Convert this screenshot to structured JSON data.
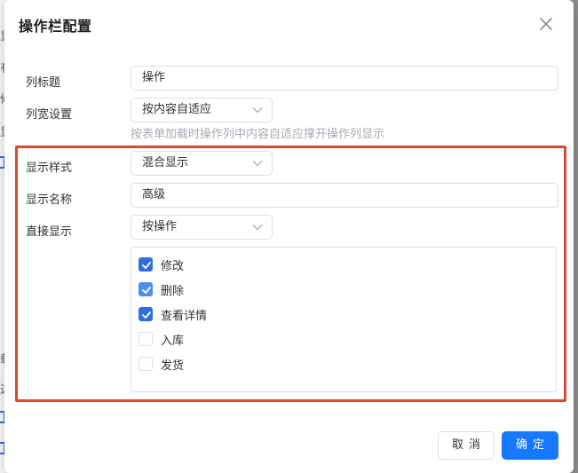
{
  "dialog": {
    "title": "操作栏配置",
    "fields": {
      "column_title": {
        "label": "列标题",
        "value": "操作"
      },
      "column_width": {
        "label": "列宽设置",
        "value": "按内容自适应",
        "hint": "按表单加载时操作列中内容自适应撑开操作列显示"
      },
      "display_style": {
        "label": "显示样式",
        "value": "混合显示"
      },
      "display_name": {
        "label": "显示名称",
        "value": "高级"
      },
      "direct_display": {
        "label": "直接显示",
        "value": "按操作"
      }
    },
    "operations": [
      {
        "label": "修改",
        "checked": true
      },
      {
        "label": "删除",
        "checked": true
      },
      {
        "label": "查看详情",
        "checked": true
      },
      {
        "label": "入库",
        "checked": false
      },
      {
        "label": "发货",
        "checked": false
      }
    ],
    "buttons": {
      "cancel": "取消",
      "ok": "确定"
    },
    "colors": {
      "primary": "#1677ff",
      "checkbox_checked": "#2e6fe0",
      "highlight_border": "#d64a36"
    }
  },
  "background": {
    "glyphs": [
      "显",
      "有",
      "修",
      "显",
      "载",
      "这"
    ]
  }
}
